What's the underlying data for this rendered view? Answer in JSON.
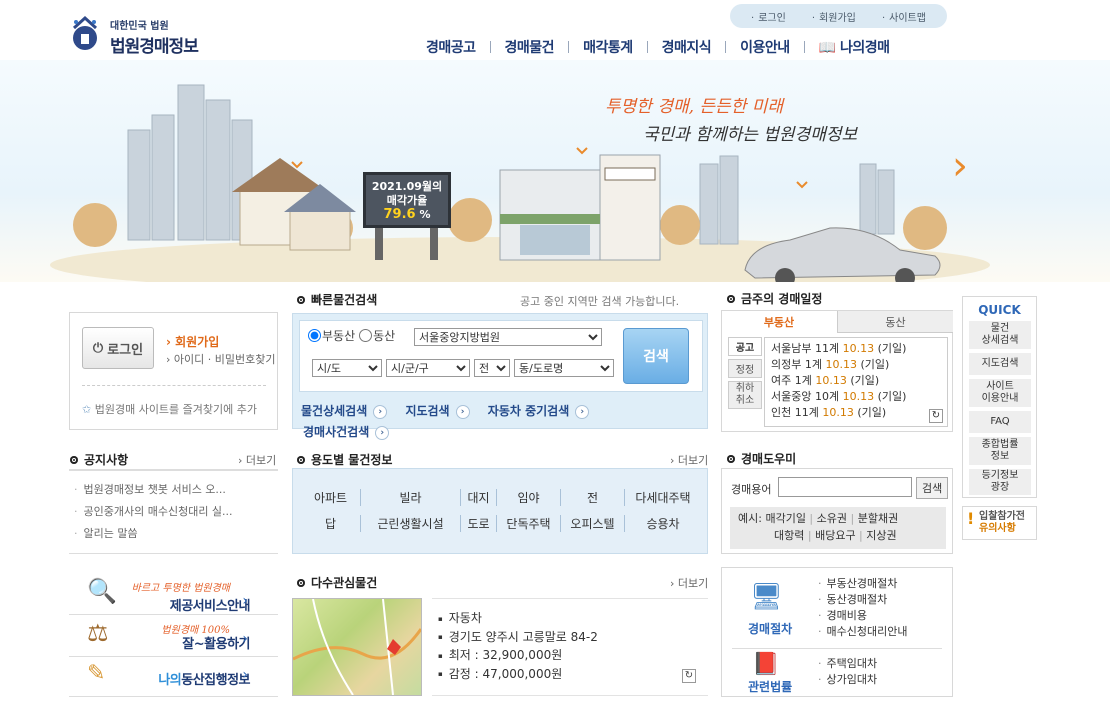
{
  "header": {
    "logo_small": "대한민국 법원",
    "logo_big": "법원경매정보",
    "util": [
      "로그인",
      "회원가입",
      "사이트맵"
    ],
    "nav": [
      "경매공고",
      "경매물건",
      "매각통계",
      "경매지식",
      "이용안내",
      "나의경매"
    ]
  },
  "hero": {
    "slogan1": "투명한 경매, 든든한 미래",
    "slogan2": "국민과 함께하는 법원경매정보",
    "billboard_line1": "2021.09월의",
    "billboard_line2": "매각가율",
    "billboard_rate": "79.6",
    "billboard_unit": "%"
  },
  "login": {
    "button": "로그인",
    "join": "회원가입",
    "find": "아이디 · 비밀번호찾기",
    "favorite": "법원경매 사이트를 즐겨찾기에 추가"
  },
  "quick_search": {
    "title": "빠른물건검색",
    "hint": "공고 중인 지역만 검색 가능합니다.",
    "radio_real": "부동산",
    "radio_movable": "동산",
    "court": "서울중앙지방법원",
    "sido": "시/도",
    "sigungu": "시/군/구",
    "all": "전",
    "dong": "동/도로명",
    "search_button": "검색",
    "links": [
      "물건상세검색",
      "지도검색",
      "자동차 중기검색",
      "경매사건검색"
    ]
  },
  "schedule": {
    "title": "금주의 경매일정",
    "tabs": [
      "부동산",
      "동산"
    ],
    "side_tabs": [
      "공고",
      "정정",
      "취하\n취소"
    ],
    "items": [
      {
        "text": "서울남부 11계 ",
        "date": "10.13",
        "suffix": " (기일)"
      },
      {
        "text": "의정부 1계 ",
        "date": "10.13",
        "suffix": " (기일)"
      },
      {
        "text": "여주 1계 ",
        "date": "10.13",
        "suffix": " (기일)"
      },
      {
        "text": "서울중앙 10계 ",
        "date": "10.13",
        "suffix": " (기일)"
      },
      {
        "text": "인천 11계 ",
        "date": "10.13",
        "suffix": " (기일)"
      }
    ]
  },
  "quick": {
    "title": "QUICK",
    "items": [
      "물건\n상세검색",
      "지도검색",
      "사이트\n이용안내",
      "FAQ",
      "종합법률\n정보",
      "등기정보\n광장"
    ],
    "caution_line1": "입찰참가전",
    "caution_line2": "유의사항"
  },
  "notice": {
    "title": "공지사항",
    "more": "더보기",
    "items": [
      "법원경매정보 챗봇 서비스 오...",
      "공인중개사의 매수신청대리 실...",
      "알리는 말씀"
    ]
  },
  "usage": {
    "title": "용도별 물건정보",
    "more": "더보기",
    "row1": [
      "아파트",
      "빌라",
      "대지",
      "임야",
      "전",
      "다세대주택"
    ],
    "row2": [
      "답",
      "근린생활시설",
      "도로",
      "단독주택",
      "오피스텔",
      "승용차"
    ]
  },
  "helper": {
    "title": "경매도우미",
    "label": "경매용어",
    "button": "검색",
    "example_label": "예시:",
    "examples_row1": [
      "매각기일",
      "소유권",
      "분할채권"
    ],
    "examples_row2": [
      "대항력",
      "배당요구",
      "지상권"
    ]
  },
  "popular": {
    "title": "다수관심물건",
    "more": "더보기",
    "details": [
      "자동차",
      "경기도 양주시 고릉말로 84-2",
      "최저 : 32,900,000원",
      "감정 : 47,000,000원"
    ]
  },
  "procedure": {
    "label": "경매절차",
    "items": [
      "부동산경매절차",
      "동산경매절차",
      "경매비용",
      "매수신청대리안내"
    ],
    "law_label": "관련법률",
    "law_items": [
      "주택임대차",
      "상가임대차"
    ]
  },
  "services": [
    {
      "script": "바르고 투명한 법원경매",
      "label": "제공서비스안내"
    },
    {
      "script": "법원경매 100%",
      "label": "잘~활용하기"
    },
    {
      "script": "",
      "label_prefix": "나의",
      "label": "동산집행정보"
    }
  ]
}
